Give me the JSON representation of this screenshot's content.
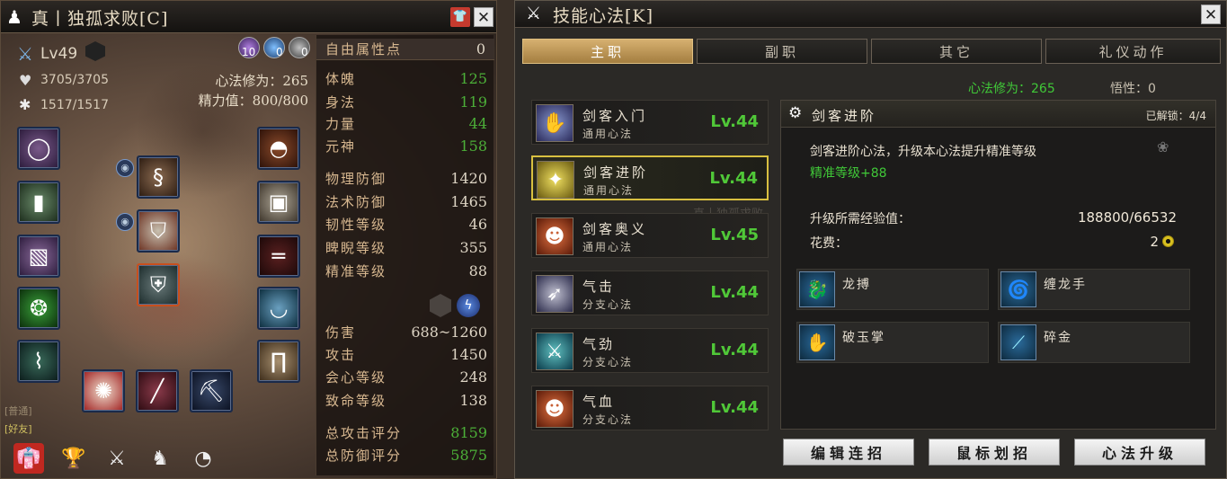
{
  "character": {
    "title": "真丨独孤求败[C]",
    "level": "Lv49",
    "hp": "3705/3705",
    "mp": "1517/1517",
    "xiulian_label": "心法修为：",
    "xiulian_value": "265",
    "energy_label": "精力值：",
    "energy_value": "800/800",
    "bead_counts": [
      "10",
      "0",
      "0"
    ],
    "stats_top": [
      {
        "k": "自由属性点",
        "v": "0"
      },
      {
        "k": "体魄",
        "v": "125"
      },
      {
        "k": "身法",
        "v": "119"
      },
      {
        "k": "力量",
        "v": "44"
      },
      {
        "k": "元神",
        "v": "158"
      }
    ],
    "stats_def": [
      {
        "k": "物理防御",
        "v": "1420"
      },
      {
        "k": "法术防御",
        "v": "1465"
      },
      {
        "k": "韧性等级",
        "v": "46"
      },
      {
        "k": "睥睨等级",
        "v": "355"
      },
      {
        "k": "精准等级",
        "v": "88"
      }
    ],
    "stats_atk": [
      {
        "k": "伤害",
        "v": "688~1260"
      },
      {
        "k": "攻击",
        "v": "1450"
      },
      {
        "k": "会心等级",
        "v": "248"
      },
      {
        "k": "致命等级",
        "v": "138"
      }
    ],
    "stats_score": [
      {
        "k": "总攻击评分",
        "v": "8159"
      },
      {
        "k": "总防御评分",
        "v": "5875"
      }
    ],
    "chat_fragments": [
      "[普通]",
      "[好友]"
    ]
  },
  "skill": {
    "title": "技能心法[K]",
    "tabs": [
      "主职",
      "副职",
      "其它",
      "礼仪动作"
    ],
    "xiulian": "心法修为：265",
    "wuxing": "悟性：0",
    "skills": [
      {
        "name": "剑客入门",
        "type": "通用心法",
        "level": "Lv.44"
      },
      {
        "name": "剑客进阶",
        "type": "通用心法",
        "level": "Lv.44"
      },
      {
        "name": "剑客奥义",
        "type": "通用心法",
        "level": "Lv.45"
      },
      {
        "name": "气击",
        "type": "分支心法",
        "level": "Lv.44"
      },
      {
        "name": "气劲",
        "type": "分支心法",
        "level": "Lv.44"
      },
      {
        "name": "气血",
        "type": "分支心法",
        "level": "Lv.44"
      }
    ],
    "detail": {
      "name": "剑客进阶",
      "unlocked": "已解锁：4/4",
      "desc": "剑客进阶心法，升级本心法提升精准等级",
      "bonus": "精准等级+88",
      "exp_label": "升级所需经验值：",
      "exp_value": "188800/66532",
      "cost_label": "花费：",
      "cost_value": "2",
      "moves": [
        "龙搏",
        "缠龙手",
        "破玉掌",
        "碎金"
      ]
    },
    "buttons": [
      "编辑连招",
      "鼠标划招",
      "心法升级"
    ],
    "ghost_text": [
      "知香",
      "真丨独孤求败"
    ]
  }
}
